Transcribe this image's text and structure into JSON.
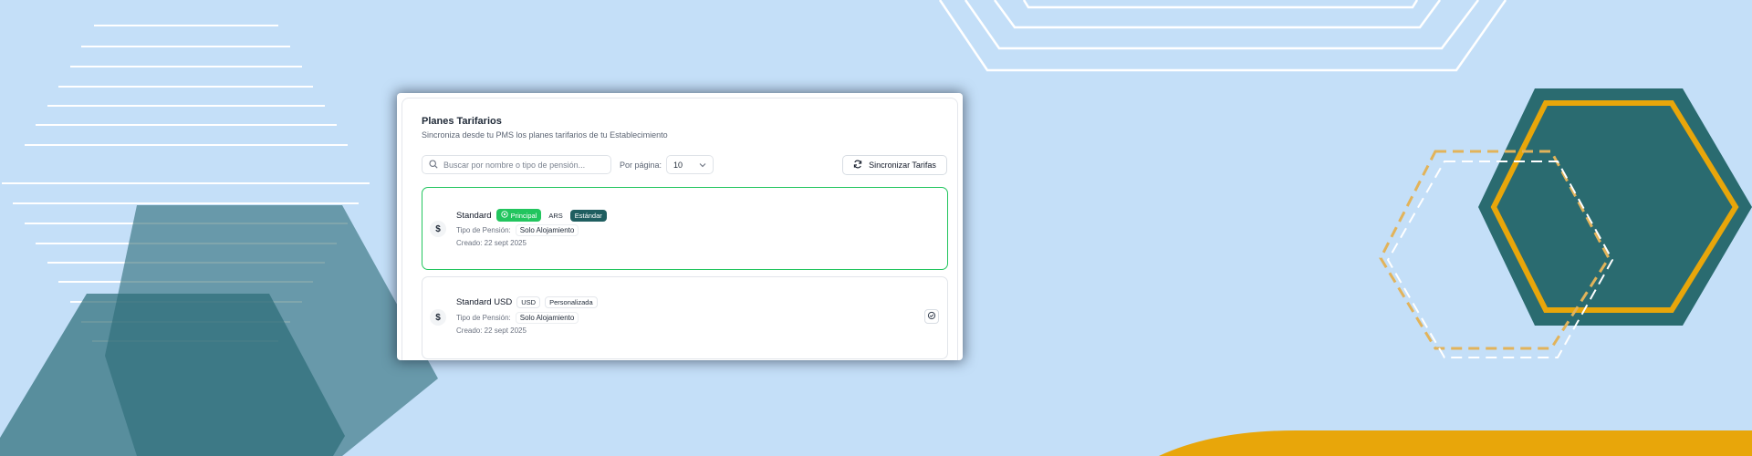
{
  "colors": {
    "background": "#c4dff8",
    "teal": "#2a6b70",
    "gold": "#e8a60a",
    "accent_green": "#22c55e",
    "badge_teal": "#1f5e60"
  },
  "header": {
    "title": "Planes Tarifarios",
    "subtitle": "Sincroniza desde tu PMS los planes tarifarios de tu Establecimiento"
  },
  "toolbar": {
    "search_placeholder": "Buscar por nombre o tipo de pensión...",
    "per_page_label": "Por página:",
    "per_page_value": "10",
    "sync_label": "Sincronizar Tarifas"
  },
  "plans": [
    {
      "name": "Standard",
      "badges": [
        "Principal",
        "ARS",
        "Estándar"
      ],
      "pension_label": "Tipo de Pensión:",
      "pension_value": "Solo Alojamiento",
      "created": "Creado: 22 sept 2025"
    },
    {
      "name": "Standard USD",
      "badges": [
        "USD",
        "Personalizada"
      ],
      "pension_label": "Tipo de Pensión:",
      "pension_value": "Solo Alojamiento",
      "created": "Creado: 22 sept 2025"
    }
  ],
  "icons": [
    "search-icon",
    "chevron-down-icon",
    "refresh-icon",
    "dollar-icon",
    "star-icon",
    "check-circle-icon"
  ]
}
